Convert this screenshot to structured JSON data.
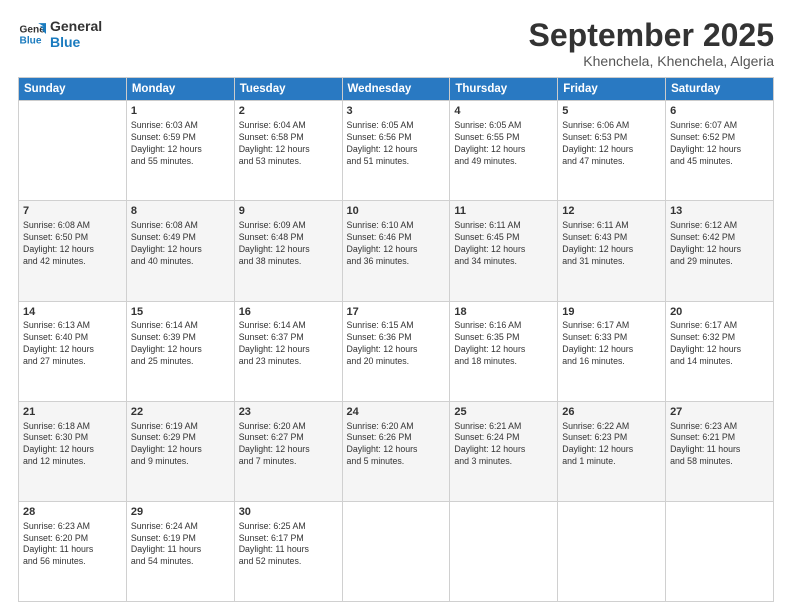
{
  "logo": {
    "line1": "General",
    "line2": "Blue"
  },
  "header": {
    "month": "September 2025",
    "location": "Khenchela, Khenchela, Algeria"
  },
  "weekdays": [
    "Sunday",
    "Monday",
    "Tuesday",
    "Wednesday",
    "Thursday",
    "Friday",
    "Saturday"
  ],
  "weeks": [
    [
      {
        "day": "",
        "info": ""
      },
      {
        "day": "1",
        "info": "Sunrise: 6:03 AM\nSunset: 6:59 PM\nDaylight: 12 hours\nand 55 minutes."
      },
      {
        "day": "2",
        "info": "Sunrise: 6:04 AM\nSunset: 6:58 PM\nDaylight: 12 hours\nand 53 minutes."
      },
      {
        "day": "3",
        "info": "Sunrise: 6:05 AM\nSunset: 6:56 PM\nDaylight: 12 hours\nand 51 minutes."
      },
      {
        "day": "4",
        "info": "Sunrise: 6:05 AM\nSunset: 6:55 PM\nDaylight: 12 hours\nand 49 minutes."
      },
      {
        "day": "5",
        "info": "Sunrise: 6:06 AM\nSunset: 6:53 PM\nDaylight: 12 hours\nand 47 minutes."
      },
      {
        "day": "6",
        "info": "Sunrise: 6:07 AM\nSunset: 6:52 PM\nDaylight: 12 hours\nand 45 minutes."
      }
    ],
    [
      {
        "day": "7",
        "info": "Sunrise: 6:08 AM\nSunset: 6:50 PM\nDaylight: 12 hours\nand 42 minutes."
      },
      {
        "day": "8",
        "info": "Sunrise: 6:08 AM\nSunset: 6:49 PM\nDaylight: 12 hours\nand 40 minutes."
      },
      {
        "day": "9",
        "info": "Sunrise: 6:09 AM\nSunset: 6:48 PM\nDaylight: 12 hours\nand 38 minutes."
      },
      {
        "day": "10",
        "info": "Sunrise: 6:10 AM\nSunset: 6:46 PM\nDaylight: 12 hours\nand 36 minutes."
      },
      {
        "day": "11",
        "info": "Sunrise: 6:11 AM\nSunset: 6:45 PM\nDaylight: 12 hours\nand 34 minutes."
      },
      {
        "day": "12",
        "info": "Sunrise: 6:11 AM\nSunset: 6:43 PM\nDaylight: 12 hours\nand 31 minutes."
      },
      {
        "day": "13",
        "info": "Sunrise: 6:12 AM\nSunset: 6:42 PM\nDaylight: 12 hours\nand 29 minutes."
      }
    ],
    [
      {
        "day": "14",
        "info": "Sunrise: 6:13 AM\nSunset: 6:40 PM\nDaylight: 12 hours\nand 27 minutes."
      },
      {
        "day": "15",
        "info": "Sunrise: 6:14 AM\nSunset: 6:39 PM\nDaylight: 12 hours\nand 25 minutes."
      },
      {
        "day": "16",
        "info": "Sunrise: 6:14 AM\nSunset: 6:37 PM\nDaylight: 12 hours\nand 23 minutes."
      },
      {
        "day": "17",
        "info": "Sunrise: 6:15 AM\nSunset: 6:36 PM\nDaylight: 12 hours\nand 20 minutes."
      },
      {
        "day": "18",
        "info": "Sunrise: 6:16 AM\nSunset: 6:35 PM\nDaylight: 12 hours\nand 18 minutes."
      },
      {
        "day": "19",
        "info": "Sunrise: 6:17 AM\nSunset: 6:33 PM\nDaylight: 12 hours\nand 16 minutes."
      },
      {
        "day": "20",
        "info": "Sunrise: 6:17 AM\nSunset: 6:32 PM\nDaylight: 12 hours\nand 14 minutes."
      }
    ],
    [
      {
        "day": "21",
        "info": "Sunrise: 6:18 AM\nSunset: 6:30 PM\nDaylight: 12 hours\nand 12 minutes."
      },
      {
        "day": "22",
        "info": "Sunrise: 6:19 AM\nSunset: 6:29 PM\nDaylight: 12 hours\nand 9 minutes."
      },
      {
        "day": "23",
        "info": "Sunrise: 6:20 AM\nSunset: 6:27 PM\nDaylight: 12 hours\nand 7 minutes."
      },
      {
        "day": "24",
        "info": "Sunrise: 6:20 AM\nSunset: 6:26 PM\nDaylight: 12 hours\nand 5 minutes."
      },
      {
        "day": "25",
        "info": "Sunrise: 6:21 AM\nSunset: 6:24 PM\nDaylight: 12 hours\nand 3 minutes."
      },
      {
        "day": "26",
        "info": "Sunrise: 6:22 AM\nSunset: 6:23 PM\nDaylight: 12 hours\nand 1 minute."
      },
      {
        "day": "27",
        "info": "Sunrise: 6:23 AM\nSunset: 6:21 PM\nDaylight: 11 hours\nand 58 minutes."
      }
    ],
    [
      {
        "day": "28",
        "info": "Sunrise: 6:23 AM\nSunset: 6:20 PM\nDaylight: 11 hours\nand 56 minutes."
      },
      {
        "day": "29",
        "info": "Sunrise: 6:24 AM\nSunset: 6:19 PM\nDaylight: 11 hours\nand 54 minutes."
      },
      {
        "day": "30",
        "info": "Sunrise: 6:25 AM\nSunset: 6:17 PM\nDaylight: 11 hours\nand 52 minutes."
      },
      {
        "day": "",
        "info": ""
      },
      {
        "day": "",
        "info": ""
      },
      {
        "day": "",
        "info": ""
      },
      {
        "day": "",
        "info": ""
      }
    ]
  ]
}
